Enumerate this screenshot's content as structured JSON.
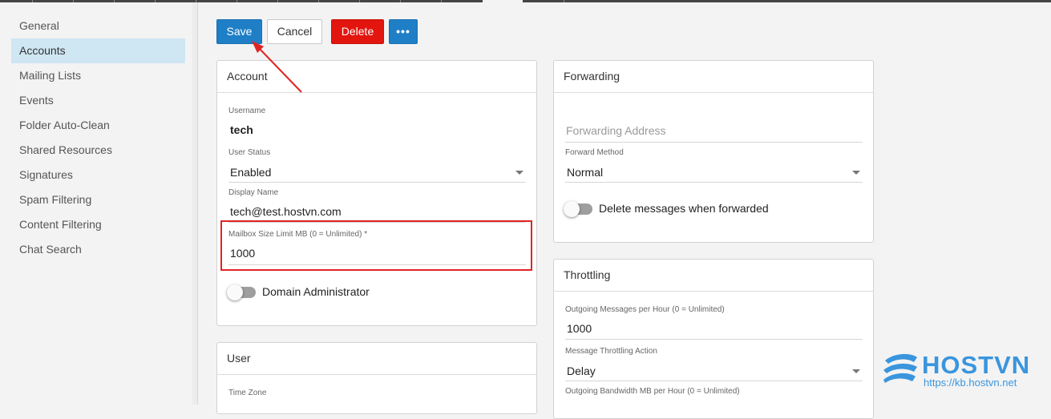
{
  "sidebar": {
    "items": [
      {
        "label": "General",
        "active": false
      },
      {
        "label": "Accounts",
        "active": true
      },
      {
        "label": "Mailing Lists",
        "active": false
      },
      {
        "label": "Events",
        "active": false
      },
      {
        "label": "Folder Auto-Clean",
        "active": false
      },
      {
        "label": "Shared Resources",
        "active": false
      },
      {
        "label": "Signatures",
        "active": false
      },
      {
        "label": "Spam Filtering",
        "active": false
      },
      {
        "label": "Content Filtering",
        "active": false
      },
      {
        "label": "Chat Search",
        "active": false
      }
    ]
  },
  "toolbar": {
    "save_label": "Save",
    "cancel_label": "Cancel",
    "delete_label": "Delete",
    "more_label": "•••",
    "colors": {
      "primary": "#1e7fc6",
      "danger": "#e2160f"
    }
  },
  "account": {
    "title": "Account",
    "username_label": "Username",
    "username_value": "tech",
    "status_label": "User Status",
    "status_value": "Enabled",
    "display_name_label": "Display Name",
    "display_name_value": "tech@test.hostvn.com",
    "mailbox_label": "Mailbox Size Limit MB (0 = Unlimited) *",
    "mailbox_value": "1000",
    "domain_admin_label": "Domain Administrator",
    "domain_admin_on": false
  },
  "user": {
    "title": "User",
    "timezone_label": "Time Zone"
  },
  "forwarding": {
    "title": "Forwarding",
    "address_placeholder": "Forwarding Address",
    "method_label": "Forward Method",
    "method_value": "Normal",
    "delete_label": "Delete messages when forwarded",
    "delete_on": false
  },
  "throttling": {
    "title": "Throttling",
    "outgoing_label": "Outgoing Messages per Hour (0 = Unlimited)",
    "outgoing_value": "1000",
    "action_label": "Message Throttling Action",
    "action_value": "Delay",
    "bandwidth_label": "Outgoing Bandwidth MB per Hour (0 = Unlimited)"
  },
  "annotation_color": "#e02424",
  "watermark": {
    "brand": "HOSTVN",
    "url": "https://kb.hostvn.net",
    "color": "#3a95dd"
  }
}
